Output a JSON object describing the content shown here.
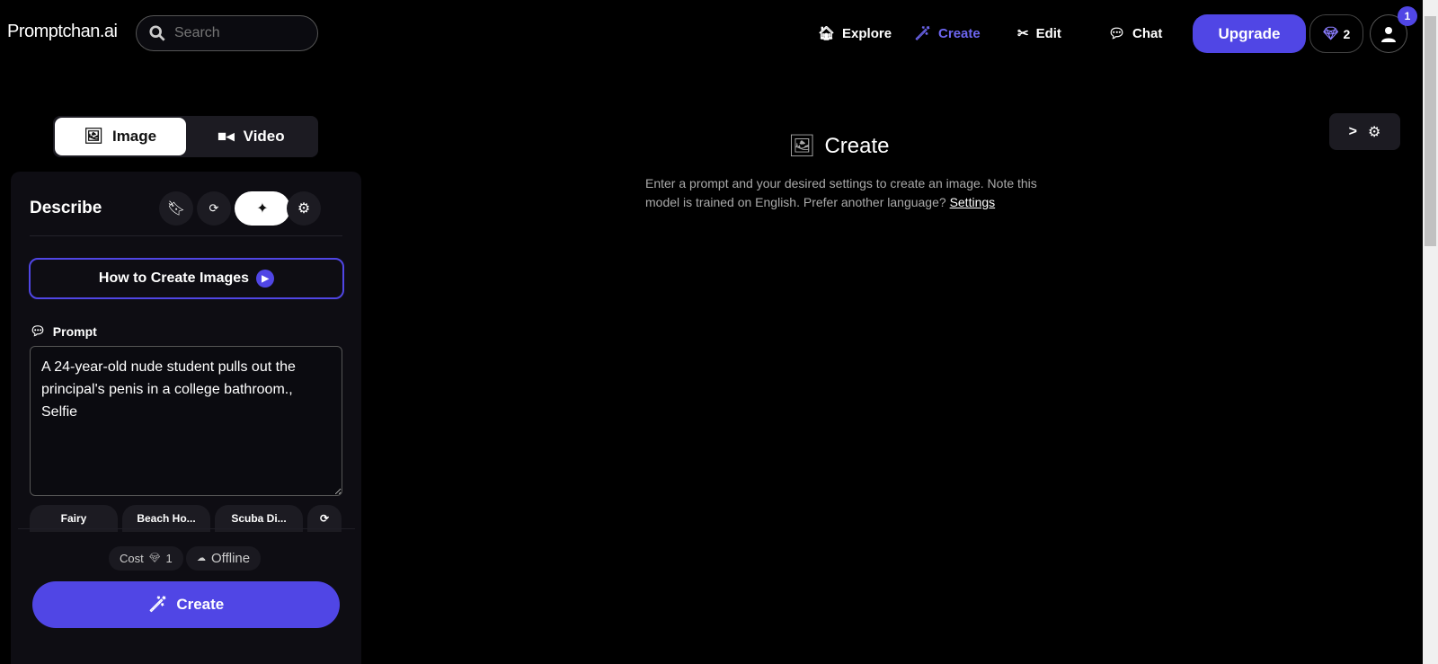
{
  "header": {
    "logo": "Promptchan.ai",
    "search_placeholder": "Search",
    "nav": [
      {
        "label": "Explore",
        "icon": "home-icon"
      },
      {
        "label": "Create",
        "icon": "magic-wand-icon",
        "active": true
      },
      {
        "label": "Edit",
        "icon": "scissors-icon"
      },
      {
        "label": "Chat",
        "icon": "chat-icon"
      }
    ],
    "upgrade": "Upgrade",
    "gems": "2",
    "notification_count": "1"
  },
  "colors": {
    "accent": "#5046e5",
    "background": "#000000",
    "panel": "#0e0d13"
  },
  "mode_toggle": {
    "image": "Image",
    "video": "Video",
    "selected": "Image"
  },
  "panel": {
    "title": "Describe",
    "how_to": "How to Create Images",
    "prompt_label": "Prompt",
    "prompt_value": "A 24-year-old nude student pulls out the principal's penis in a college bathroom., Selfie",
    "chips": [
      "Fairy",
      "Beach Ho...",
      "Scuba Di..."
    ],
    "cost_label": "Cost",
    "cost_value": "1",
    "status": "Offline",
    "create": "Create"
  },
  "main": {
    "title": "Create",
    "description": "Enter a prompt and your desired settings to create an image. Note this model is trained on English. Prefer another language?",
    "settings_link": "Settings"
  }
}
